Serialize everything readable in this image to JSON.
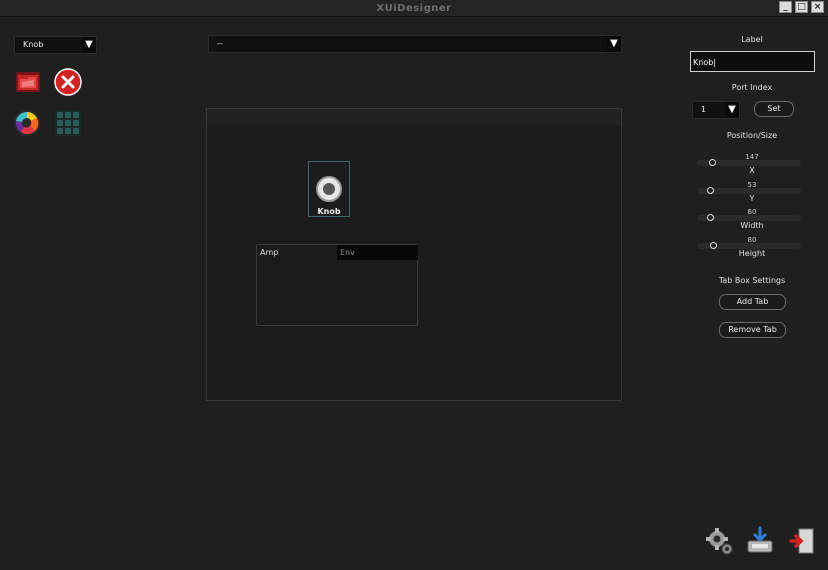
{
  "window": {
    "title": "XUiDesigner",
    "minimize": "_",
    "maximize": "□",
    "close": "×"
  },
  "controls": {
    "widget_type": "Knob",
    "plugin_select": "--",
    "arrow": "▼"
  },
  "canvas": {
    "knob_label": "Knob",
    "tabs": [
      "Amp",
      "Env"
    ]
  },
  "panel": {
    "label_heading": "Label",
    "label_value": "Knob|",
    "port_index_heading": "Port Index",
    "port_index_value": "1",
    "set_button": "Set",
    "position_size_heading": "Position/Size",
    "x": {
      "value": "147",
      "name": "X",
      "level": 0.12
    },
    "y": {
      "value": "53",
      "name": "Y",
      "level": 0.1
    },
    "width": {
      "value": "60",
      "name": "Width",
      "level": 0.1
    },
    "height": {
      "value": "80",
      "name": "Height",
      "level": 0.13
    },
    "tab_box_heading": "Tab Box Settings",
    "add_tab": "Add Tab",
    "remove_tab": "Remove Tab"
  },
  "icons": {
    "tools": [
      "folder-icon",
      "close-circle-icon",
      "color-wheel-icon",
      "grid-icon"
    ],
    "bottom": [
      "settings-icon",
      "save-icon",
      "exit-icon"
    ]
  }
}
